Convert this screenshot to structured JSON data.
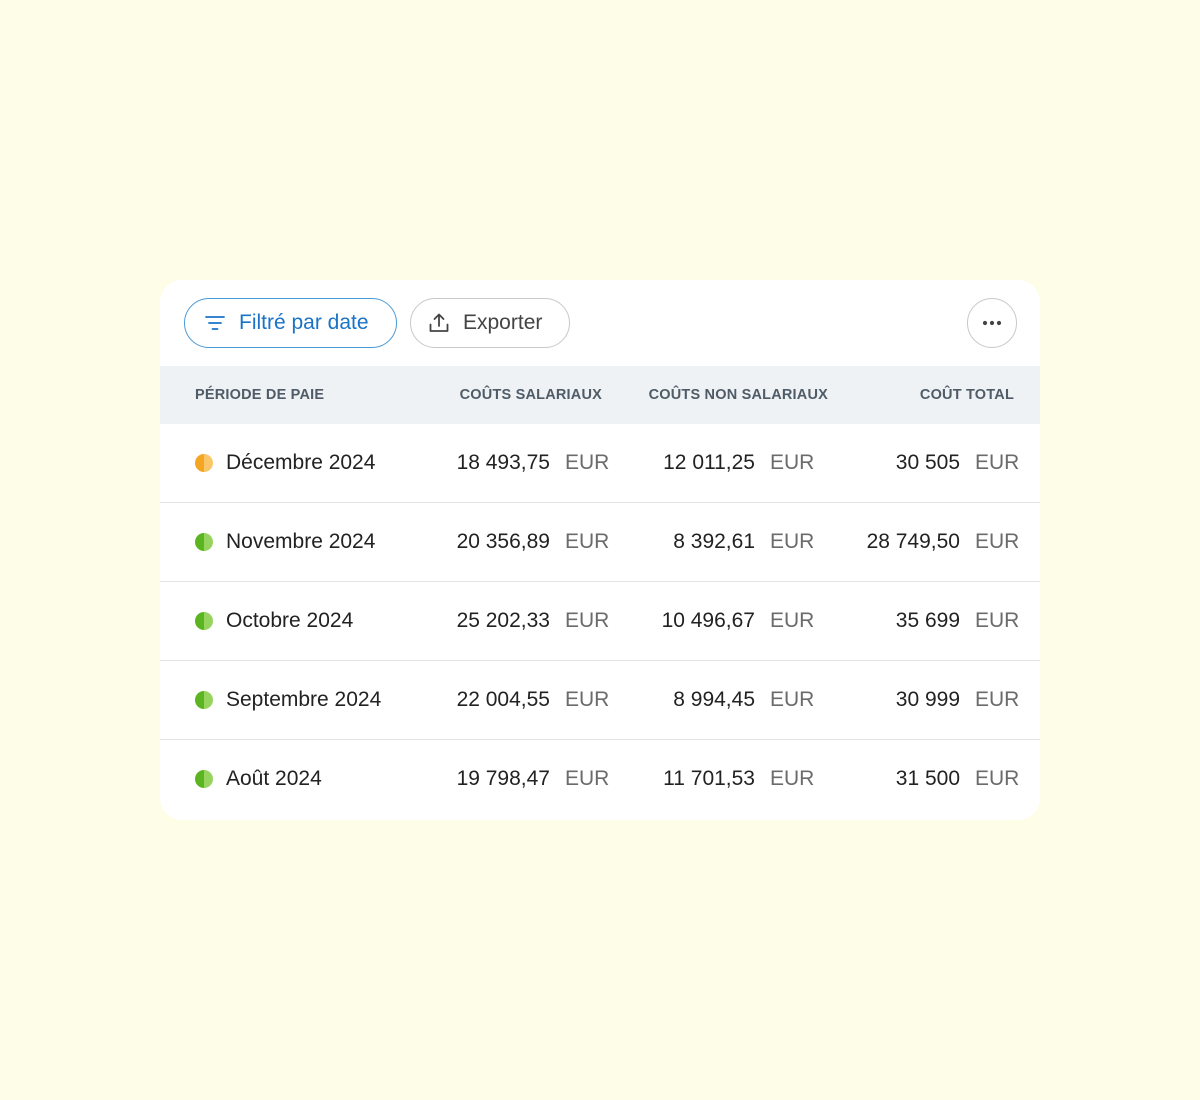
{
  "toolbar": {
    "filter_label": "Filtré par date",
    "export_label": "Exporter"
  },
  "colors": {
    "accent_blue": "#1a73c8",
    "status_partial": "#f4a623",
    "status_complete": "#5bb520"
  },
  "table": {
    "headers": {
      "period": "PÉRIODE DE PAIE",
      "salary": "COÛTS SALARIAUX",
      "non_salary": "COÛTS NON SALARIAUX",
      "total": "COÛT TOTAL"
    },
    "rows": [
      {
        "status": "partial",
        "period": "Décembre 2024",
        "salary": "18 493,75",
        "salary_currency": "EUR",
        "non_salary": "12 011,25",
        "non_salary_currency": "EUR",
        "total": "30 505",
        "total_currency": "EUR"
      },
      {
        "status": "complete",
        "period": "Novembre 2024",
        "salary": "20 356,89",
        "salary_currency": "EUR",
        "non_salary": "8 392,61",
        "non_salary_currency": "EUR",
        "total": "28 749,50",
        "total_currency": "EUR"
      },
      {
        "status": "complete",
        "period": "Octobre 2024",
        "salary": "25 202,33",
        "salary_currency": "EUR",
        "non_salary": "10 496,67",
        "non_salary_currency": "EUR",
        "total": "35 699",
        "total_currency": "EUR"
      },
      {
        "status": "complete",
        "period": "Septembre 2024",
        "salary": "22 004,55",
        "salary_currency": "EUR",
        "non_salary": "8 994,45",
        "non_salary_currency": "EUR",
        "total": "30 999",
        "total_currency": "EUR"
      },
      {
        "status": "complete",
        "period": "Août 2024",
        "salary": "19 798,47",
        "salary_currency": "EUR",
        "non_salary": "11 701,53",
        "non_salary_currency": "EUR",
        "total": "31 500",
        "total_currency": "EUR"
      }
    ]
  }
}
